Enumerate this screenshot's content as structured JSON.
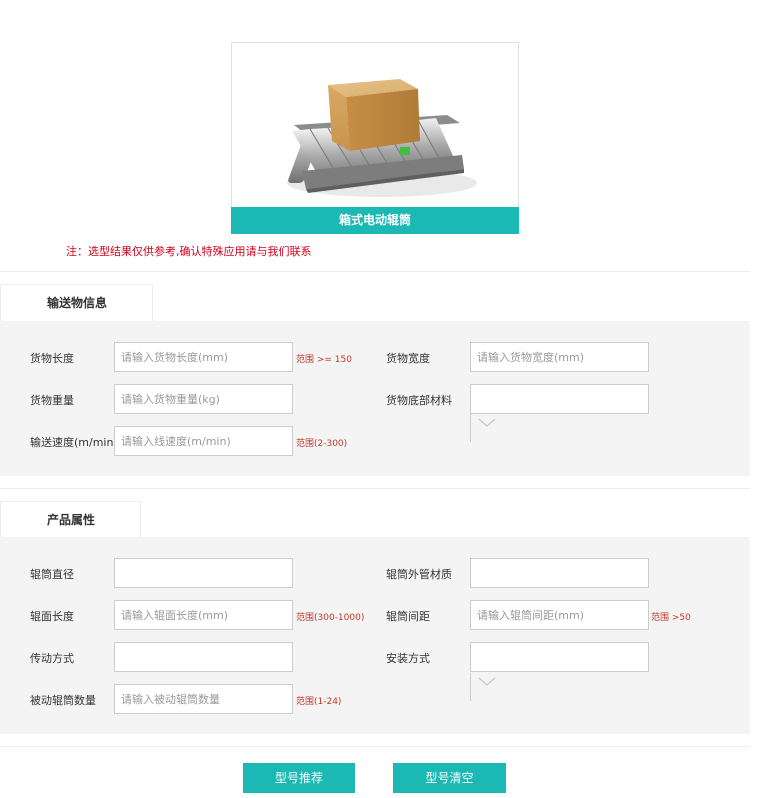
{
  "product": {
    "caption": "箱式电动辊筒",
    "image_icon": "roller-conveyor-with-box-image"
  },
  "note": "注：选型结果仅供参考,确认特殊应用请与我们联系",
  "sections": {
    "conveyed_goods": {
      "title": "输送物信息",
      "fields": {
        "length": {
          "label": "货物长度",
          "placeholder": "请输入货物长度(mm)",
          "hint": "范围 >= 150"
        },
        "width": {
          "label": "货物宽度",
          "placeholder": "请输入货物宽度(mm)"
        },
        "weight": {
          "label": "货物重量",
          "placeholder": "请输入货物重量(kg)"
        },
        "bottom_material": {
          "label": "货物底部材料",
          "value": ""
        },
        "speed": {
          "label": "输送速度(m/min)",
          "placeholder": "请输入线速度(m/min)",
          "hint": "范围(2-300)"
        }
      }
    },
    "product_props": {
      "title": "产品属性",
      "fields": {
        "diameter": {
          "label": "辊筒直径",
          "value": ""
        },
        "tube_material": {
          "label": "辊筒外管材质",
          "value": ""
        },
        "face_length": {
          "label": "辊面长度",
          "placeholder": "请输入辊面长度(mm)",
          "hint": "范围(300-1000)"
        },
        "spacing": {
          "label": "辊筒间距",
          "placeholder": "请输入辊筒间距(mm)",
          "hint": "范围 >50"
        },
        "drive_mode": {
          "label": "传动方式",
          "value": ""
        },
        "install_mode": {
          "label": "安装方式",
          "value": ""
        },
        "passive_count": {
          "label": "被动辊筒数量",
          "placeholder": "请输入被动辊筒数量",
          "hint": "范围(1-24)"
        }
      }
    }
  },
  "buttons": {
    "recommend": "型号推荐",
    "clear": "型号清空"
  },
  "colors": {
    "accent": "#1bb8b4",
    "note": "#d0021b",
    "panel": "#f4f4f4"
  }
}
